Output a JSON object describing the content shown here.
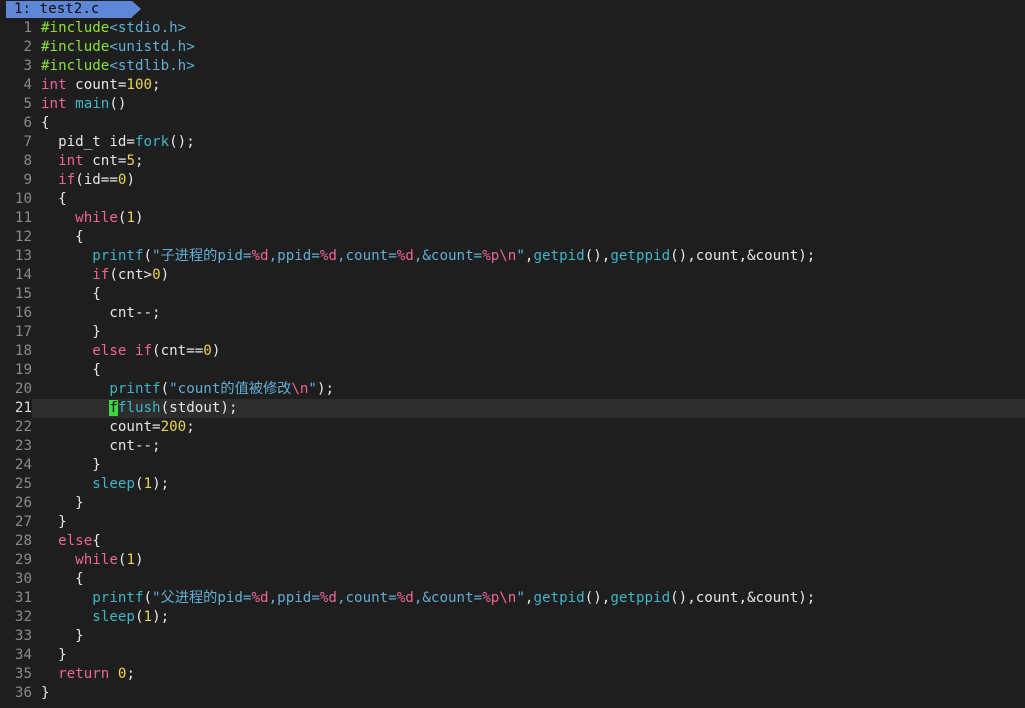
{
  "tab": {
    "label": "1: test2.c"
  },
  "editor": {
    "current_line": 21,
    "colors": {
      "background": "#1e1e1e",
      "current_line_bg": "#2d2d2d",
      "tab_bg": "#5f87d7",
      "cursor": "#3cd93c",
      "keyword": "#f0629a",
      "number": "#e8d44d",
      "function": "#3cb6c8",
      "string": "#5fafd7",
      "preprocessor": "#8ae234"
    },
    "lines": [
      {
        "n": "1",
        "tokens": [
          [
            "pre",
            "#include"
          ],
          [
            "hdr",
            "<stdio.h>"
          ]
        ]
      },
      {
        "n": "2",
        "tokens": [
          [
            "pre",
            "#include"
          ],
          [
            "hdr",
            "<unistd.h>"
          ]
        ]
      },
      {
        "n": "3",
        "tokens": [
          [
            "pre",
            "#include"
          ],
          [
            "hdr",
            "<stdlib.h>"
          ]
        ]
      },
      {
        "n": "4",
        "tokens": [
          [
            "type",
            "int"
          ],
          [
            "plain",
            " count="
          ],
          [
            "num",
            "100"
          ],
          [
            "plain",
            ";"
          ]
        ]
      },
      {
        "n": "5",
        "tokens": [
          [
            "type",
            "int"
          ],
          [
            "plain",
            " "
          ],
          [
            "fn",
            "main"
          ],
          [
            "plain",
            "()"
          ]
        ]
      },
      {
        "n": "6",
        "tokens": [
          [
            "plain",
            "{"
          ]
        ]
      },
      {
        "n": "7",
        "tokens": [
          [
            "plain",
            "  pid_t id="
          ],
          [
            "fn",
            "fork"
          ],
          [
            "plain",
            "();"
          ]
        ]
      },
      {
        "n": "8",
        "tokens": [
          [
            "plain",
            "  "
          ],
          [
            "type",
            "int"
          ],
          [
            "plain",
            " cnt="
          ],
          [
            "num",
            "5"
          ],
          [
            "plain",
            ";"
          ]
        ]
      },
      {
        "n": "9",
        "tokens": [
          [
            "plain",
            "  "
          ],
          [
            "kw",
            "if"
          ],
          [
            "plain",
            "(id=="
          ],
          [
            "num",
            "0"
          ],
          [
            "plain",
            ")"
          ]
        ]
      },
      {
        "n": "10",
        "tokens": [
          [
            "plain",
            "  {"
          ]
        ]
      },
      {
        "n": "11",
        "tokens": [
          [
            "plain",
            "    "
          ],
          [
            "kw",
            "while"
          ],
          [
            "plain",
            "("
          ],
          [
            "num",
            "1"
          ],
          [
            "plain",
            ")"
          ]
        ]
      },
      {
        "n": "12",
        "tokens": [
          [
            "plain",
            "    {"
          ]
        ]
      },
      {
        "n": "13",
        "tokens": [
          [
            "plain",
            "      "
          ],
          [
            "fn",
            "printf"
          ],
          [
            "plain",
            "("
          ],
          [
            "str",
            "\"子进程的pid="
          ],
          [
            "fmt",
            "%d"
          ],
          [
            "str",
            ",ppid="
          ],
          [
            "fmt",
            "%d"
          ],
          [
            "str",
            ",count="
          ],
          [
            "fmt",
            "%d"
          ],
          [
            "str",
            ",&count="
          ],
          [
            "fmt",
            "%p\\n"
          ],
          [
            "str",
            "\""
          ],
          [
            "plain",
            ","
          ],
          [
            "fn",
            "getpid"
          ],
          [
            "plain",
            "(),"
          ],
          [
            "fn",
            "getppid"
          ],
          [
            "plain",
            "(),count,&count);"
          ]
        ]
      },
      {
        "n": "14",
        "tokens": [
          [
            "plain",
            "      "
          ],
          [
            "kw",
            "if"
          ],
          [
            "plain",
            "(cnt>"
          ],
          [
            "num",
            "0"
          ],
          [
            "plain",
            ")"
          ]
        ]
      },
      {
        "n": "15",
        "tokens": [
          [
            "plain",
            "      {"
          ]
        ]
      },
      {
        "n": "16",
        "tokens": [
          [
            "plain",
            "        cnt--;"
          ]
        ]
      },
      {
        "n": "17",
        "tokens": [
          [
            "plain",
            "      }"
          ]
        ]
      },
      {
        "n": "18",
        "tokens": [
          [
            "plain",
            "      "
          ],
          [
            "kw",
            "else if"
          ],
          [
            "plain",
            "(cnt=="
          ],
          [
            "num",
            "0"
          ],
          [
            "plain",
            ")"
          ]
        ]
      },
      {
        "n": "19",
        "tokens": [
          [
            "plain",
            "      {"
          ]
        ]
      },
      {
        "n": "20",
        "tokens": [
          [
            "plain",
            "        "
          ],
          [
            "fn",
            "printf"
          ],
          [
            "plain",
            "("
          ],
          [
            "str",
            "\"count的值被修改"
          ],
          [
            "fmt",
            "\\n"
          ],
          [
            "str",
            "\""
          ],
          [
            "plain",
            ");"
          ]
        ]
      },
      {
        "n": "21",
        "tokens": [
          [
            "plain",
            "        "
          ],
          [
            "cursor",
            "f"
          ],
          [
            "fn",
            "flush"
          ],
          [
            "plain",
            "(stdout);"
          ]
        ]
      },
      {
        "n": "22",
        "tokens": [
          [
            "plain",
            "        count="
          ],
          [
            "num",
            "200"
          ],
          [
            "plain",
            ";"
          ]
        ]
      },
      {
        "n": "23",
        "tokens": [
          [
            "plain",
            "        cnt--;"
          ]
        ]
      },
      {
        "n": "24",
        "tokens": [
          [
            "plain",
            "      }"
          ]
        ]
      },
      {
        "n": "25",
        "tokens": [
          [
            "plain",
            "      "
          ],
          [
            "fn",
            "sleep"
          ],
          [
            "plain",
            "("
          ],
          [
            "num",
            "1"
          ],
          [
            "plain",
            ");"
          ]
        ]
      },
      {
        "n": "26",
        "tokens": [
          [
            "plain",
            "    }"
          ]
        ]
      },
      {
        "n": "27",
        "tokens": [
          [
            "plain",
            "  }"
          ]
        ]
      },
      {
        "n": "28",
        "tokens": [
          [
            "plain",
            "  "
          ],
          [
            "kw",
            "else"
          ],
          [
            "plain",
            "{"
          ]
        ]
      },
      {
        "n": "29",
        "tokens": [
          [
            "plain",
            "    "
          ],
          [
            "kw",
            "while"
          ],
          [
            "plain",
            "("
          ],
          [
            "num",
            "1"
          ],
          [
            "plain",
            ")"
          ]
        ]
      },
      {
        "n": "30",
        "tokens": [
          [
            "plain",
            "    {"
          ]
        ]
      },
      {
        "n": "31",
        "tokens": [
          [
            "plain",
            "      "
          ],
          [
            "fn",
            "printf"
          ],
          [
            "plain",
            "("
          ],
          [
            "str",
            "\"父进程的pid="
          ],
          [
            "fmt",
            "%d"
          ],
          [
            "str",
            ",ppid="
          ],
          [
            "fmt",
            "%d"
          ],
          [
            "str",
            ",count="
          ],
          [
            "fmt",
            "%d"
          ],
          [
            "str",
            ",&count="
          ],
          [
            "fmt",
            "%p\\n"
          ],
          [
            "str",
            "\""
          ],
          [
            "plain",
            ","
          ],
          [
            "fn",
            "getpid"
          ],
          [
            "plain",
            "(),"
          ],
          [
            "fn",
            "getppid"
          ],
          [
            "plain",
            "(),count,&count);"
          ]
        ]
      },
      {
        "n": "32",
        "tokens": [
          [
            "plain",
            "      "
          ],
          [
            "fn",
            "sleep"
          ],
          [
            "plain",
            "("
          ],
          [
            "num",
            "1"
          ],
          [
            "plain",
            ");"
          ]
        ]
      },
      {
        "n": "33",
        "tokens": [
          [
            "plain",
            "    }"
          ]
        ]
      },
      {
        "n": "34",
        "tokens": [
          [
            "plain",
            "  }"
          ]
        ]
      },
      {
        "n": "35",
        "tokens": [
          [
            "plain",
            "  "
          ],
          [
            "kw",
            "return"
          ],
          [
            "plain",
            " "
          ],
          [
            "num",
            "0"
          ],
          [
            "plain",
            ";"
          ]
        ]
      },
      {
        "n": "36",
        "tokens": [
          [
            "plain",
            "}"
          ]
        ]
      }
    ]
  }
}
